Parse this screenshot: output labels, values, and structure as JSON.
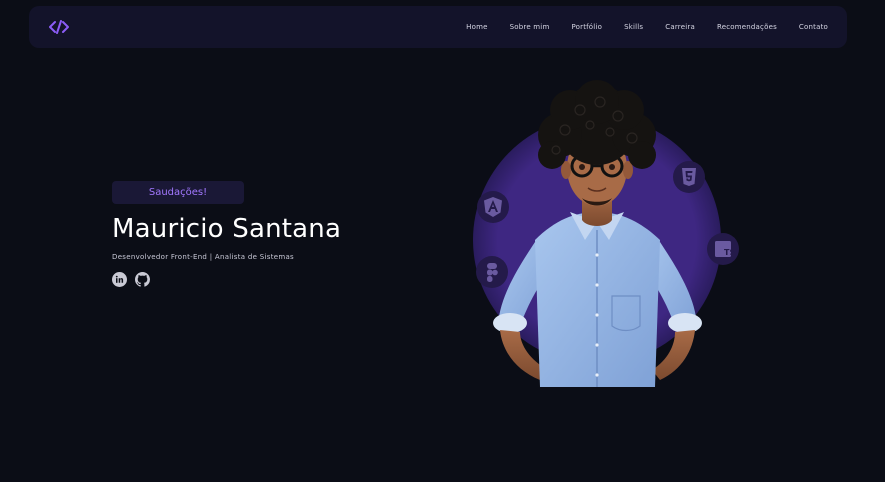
{
  "nav": {
    "logo_icon": "code-brackets-icon",
    "links": [
      "Home",
      "Sobre mim",
      "Portfólio",
      "Skills",
      "Carreira",
      "Recomendações",
      "Contato"
    ]
  },
  "hero": {
    "greeting": "Saudações!",
    "name": "Mauricio Santana",
    "subtitle": "Desenvolvedor Front-End | Analista de Sistemas",
    "socials": [
      "linkedin-icon",
      "github-icon"
    ]
  },
  "avatar": {
    "tech_icons": [
      "angular-icon",
      "html5-icon",
      "figma-icon",
      "typescript-icon"
    ],
    "ts_label": "TS"
  },
  "colors": {
    "background": "#0b0d16",
    "navbar": "#13132a",
    "accent": "#a278ff",
    "circle": "#3e2782"
  }
}
